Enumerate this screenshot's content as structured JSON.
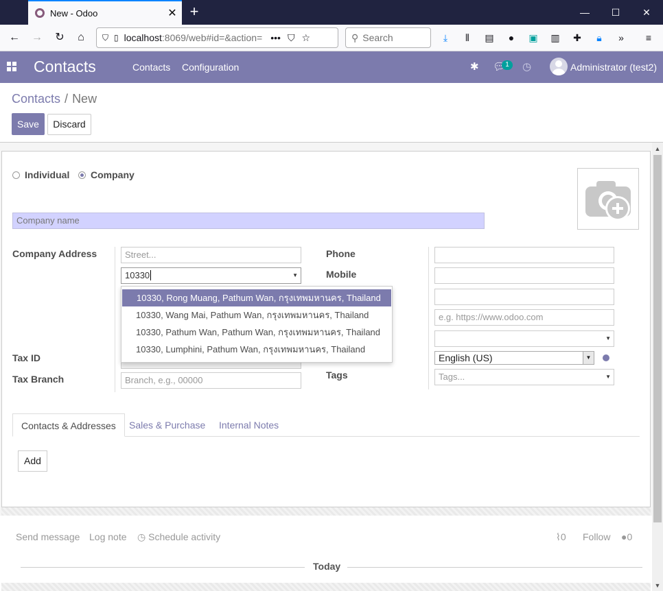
{
  "browser": {
    "tab_title": "New - Odoo",
    "url_host": "localhost",
    "url_rest": ":8069/web#id=&action=",
    "search_placeholder": "Search",
    "new_tab": "+",
    "win_min": "—",
    "win_max": "☐",
    "win_close": "✕"
  },
  "odoo": {
    "app_name": "Contacts",
    "menu": [
      "Contacts",
      "Configuration"
    ],
    "messages_badge": "1",
    "user": "Administrator (test2)"
  },
  "control_panel": {
    "breadcrumb_parent": "Contacts",
    "breadcrumb_sep": "/",
    "breadcrumb_current": "New",
    "save_label": "Save",
    "discard_label": "Discard"
  },
  "form": {
    "type_individual": "Individual",
    "type_company": "Company",
    "company_name_placeholder": "Company name",
    "company_address_label": "Company Address",
    "street_placeholder": "Street...",
    "zip_value": "10330",
    "tax_id_label": "Tax ID",
    "tax_branch_label": "Tax Branch",
    "tax_branch_placeholder": "Branch, e.g., 00000",
    "phone_label": "Phone",
    "mobile_label": "Mobile",
    "website_placeholder": "e.g. https://www.odoo.com",
    "language_value": "English (US)",
    "tags_label": "Tags",
    "tags_placeholder": "Tags..."
  },
  "autocomplete": [
    "10330, Rong Muang, Pathum Wan, กรุงเทพมหานคร, Thailand",
    "10330, Wang Mai, Pathum Wan, กรุงเทพมหานคร, Thailand",
    "10330, Pathum Wan, Pathum Wan, กรุงเทพมหานคร, Thailand",
    "10330, Lumphini, Pathum Wan, กรุงเทพมหานคร, Thailand"
  ],
  "notebook": {
    "tabs": [
      "Contacts & Addresses",
      "Sales & Purchase",
      "Internal Notes"
    ],
    "add_label": "Add"
  },
  "chatter": {
    "send_message": "Send message",
    "log_note": "Log note",
    "schedule_activity": "Schedule activity",
    "attachments_count": "0",
    "follow": "Follow",
    "followers_count": "0",
    "today": "Today"
  },
  "colors": {
    "brand": "#7c7bad",
    "teal": "#00a09d"
  }
}
